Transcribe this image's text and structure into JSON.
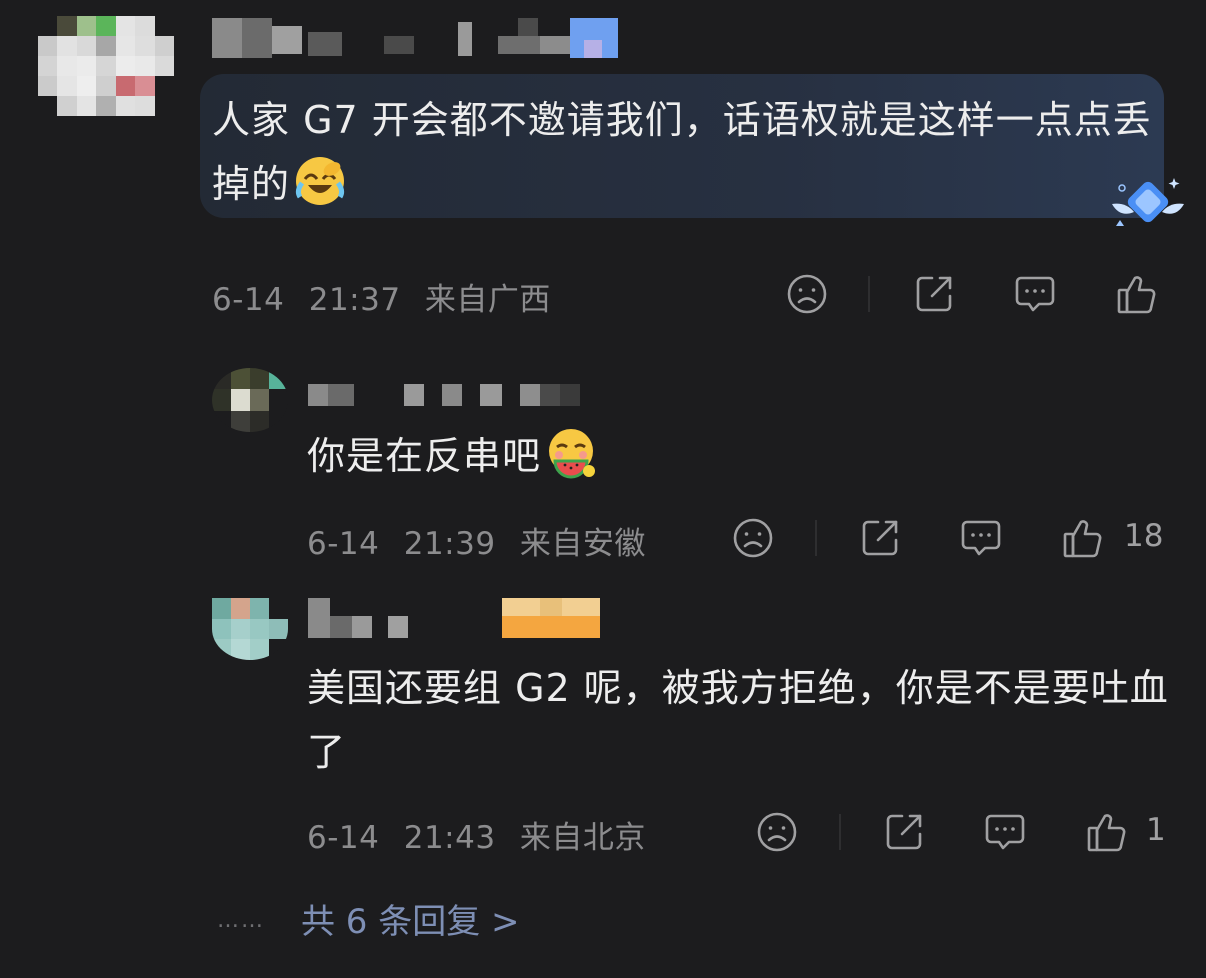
{
  "main_comment": {
    "text": "人家 G7 开会都不邀请我们，话语权就是这样一点点丢掉的",
    "emoji": "laughing-crying-emoji",
    "date": "6-14",
    "time": "21:37",
    "location": "来自广西"
  },
  "replies": [
    {
      "text": "你是在反串吧",
      "emoji": "watermelon-eating-emoji",
      "date": "6-14",
      "time": "21:39",
      "location": "来自安徽",
      "likes": "18"
    },
    {
      "text": "美国还要组 G2 呢，被我方拒绝，你是不是要吐血了",
      "date": "6-14",
      "time": "21:43",
      "location": "来自北京",
      "likes": "1"
    }
  ],
  "more_replies": {
    "dots": "……",
    "label": "共 6 条回复 >"
  },
  "colors": {
    "background": "#1c1c1e",
    "bubble_start": "#232a35",
    "bubble_end": "#2c3a52",
    "meta_text": "#8c8c8e",
    "link": "#7e8fb5"
  }
}
